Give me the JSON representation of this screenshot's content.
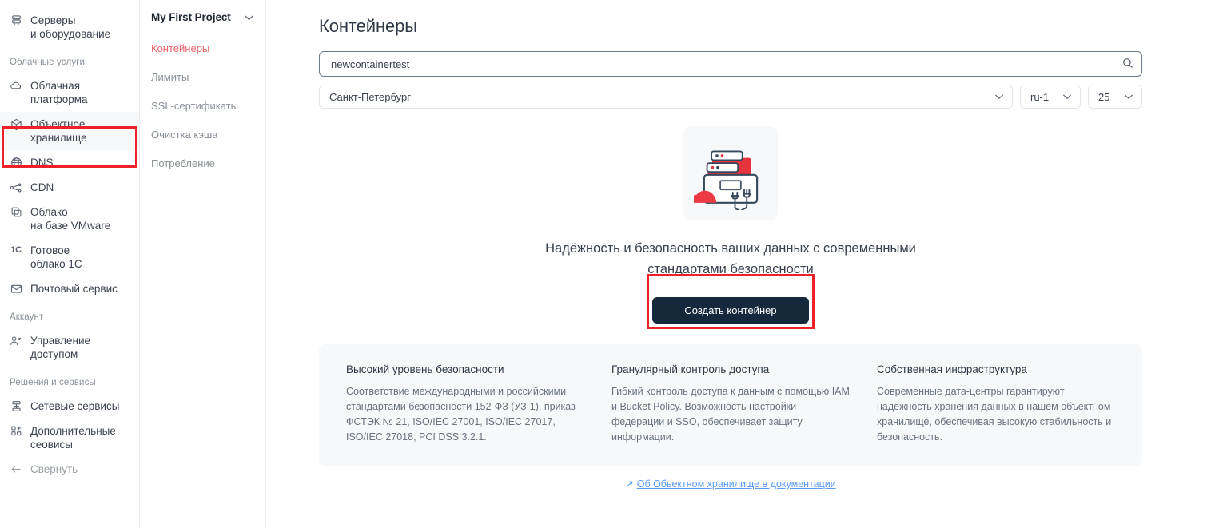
{
  "nav": {
    "items": [
      {
        "label": "Серверы\nи оборудование",
        "icon": "server-icon",
        "type": "item",
        "state": "normal"
      },
      {
        "label": "Облачные услуги",
        "type": "group"
      },
      {
        "label": "Облачная\nплатформа",
        "icon": "cloud-icon",
        "type": "item",
        "state": "normal"
      },
      {
        "label": "Объектное\nхранилище",
        "icon": "cube-icon",
        "type": "item",
        "state": "active"
      },
      {
        "label": "DNS",
        "icon": "globe-icon",
        "type": "item",
        "state": "normal"
      },
      {
        "label": "CDN",
        "icon": "cdn-icon",
        "type": "item",
        "state": "normal"
      },
      {
        "label": "Облако\nна базе VMware",
        "icon": "copy-icon",
        "type": "item",
        "state": "normal"
      },
      {
        "label": "Готовое\nоблако 1С",
        "icon": "1c-icon",
        "type": "item",
        "state": "normal"
      },
      {
        "label": "Почтовый сервис",
        "icon": "mail-icon",
        "type": "item",
        "state": "normal"
      },
      {
        "label": "Аккаунт",
        "type": "group"
      },
      {
        "label": "Управление\nдоступом",
        "icon": "users-icon",
        "type": "item",
        "state": "normal"
      },
      {
        "label": "Решения и сервисы",
        "type": "group"
      },
      {
        "label": "Сетевые сервисы",
        "icon": "network-icon",
        "type": "item",
        "state": "normal"
      },
      {
        "label": "Дополнительные\nсеовисы",
        "icon": "grid-plus-icon",
        "type": "item",
        "state": "normal"
      },
      {
        "label": "Свернуть",
        "icon": "arrow-left-icon",
        "type": "item",
        "state": "muted"
      }
    ]
  },
  "subnav": {
    "project_name": "My First Project",
    "items": [
      {
        "label": "Контейнеры",
        "current": true
      },
      {
        "label": "Лимиты",
        "current": false
      },
      {
        "label": "SSL-сертификаты",
        "current": false
      },
      {
        "label": "Очистка кэша",
        "current": false
      },
      {
        "label": "Потребление",
        "current": false
      }
    ]
  },
  "main": {
    "title": "Контейнеры",
    "search": {
      "value": "newcontainertest",
      "placeholder": "Поиск"
    },
    "filters": {
      "region": "Санкт-Петербург",
      "zone": "ru-1",
      "page_size": "25"
    },
    "empty_state": {
      "headline": "Надёжность и безопасность ваших данных с современными стандартами безопасности",
      "cta_label": "Создать контейнер"
    },
    "features": [
      {
        "title": "Высокий уровень безопасности",
        "text": "Соответствие международными и российскими стандартами безопасности 152-ФЗ (УЗ-1), приказ ФСТЭК № 21, ISO/IEC 27001, ISO/IEC 27017, ISO/IEC 27018, PCI DSS 3.2.1."
      },
      {
        "title": "Гранулярный контроль доступа",
        "text": "Гибкий контроль доступа к данным  с помощью IAM и Bucket Policy. Возможность настройки федерации и SSO, обеспечивает защиту информации."
      },
      {
        "title": "Собственная инфраструктура",
        "text": "Современные дата-центры гарантируют надёжность хранения данных в нашем объектном хранилище, обеспечивая высокую стабильность и безопасность."
      }
    ],
    "doc_link": {
      "arrow": "↗",
      "label": "Об Обьектном хранилище в документации"
    }
  },
  "colors": {
    "accent_red": "#ee2028",
    "brand_pink": "#f4646e",
    "cta_dark": "#16283c",
    "link_blue": "#5b9cf6",
    "panel_bg": "#f7f8fa"
  }
}
